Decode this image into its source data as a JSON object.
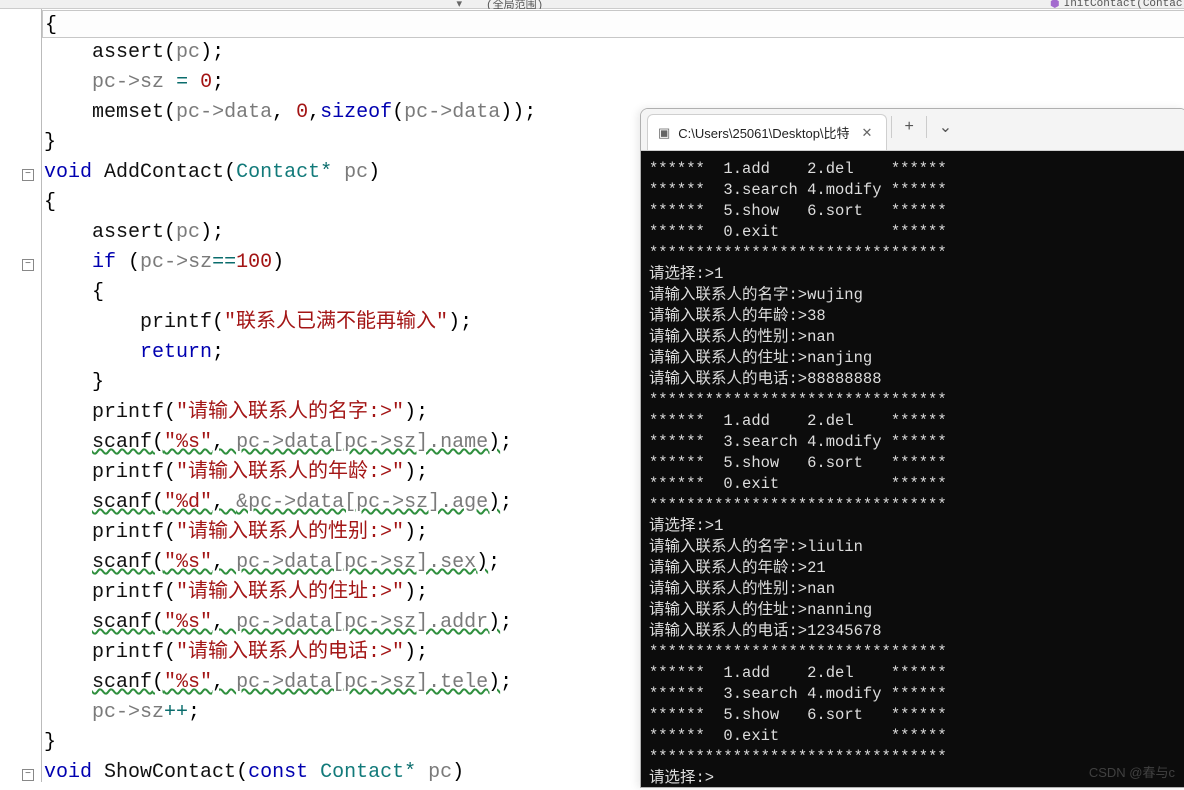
{
  "toolbar": {
    "scope_label": "(全局范围)",
    "symbol_label": "InitContact(Contac"
  },
  "code": {
    "lines": [
      {
        "indent": 0,
        "html": "{"
      },
      {
        "indent": 1,
        "html": "<span class='fn'>assert</span>(<span class='gy'>pc</span>);"
      },
      {
        "indent": 1,
        "html": "<span class='gy'>pc</span><span class='gy'>-&gt;</span><span class='gy'>sz</span> <span class='op'>=</span> <span class='num'>0</span>;"
      },
      {
        "indent": 1,
        "html": "<span class='fn'>memset</span>(<span class='gy'>pc</span><span class='gy'>-&gt;</span><span class='gy'>data</span>, <span class='num'>0</span>,<span class='kw'>sizeof</span>(<span class='gy'>pc</span><span class='gy'>-&gt;</span><span class='gy'>data</span>));"
      },
      {
        "indent": 0,
        "html": "}"
      },
      {
        "indent": 0,
        "html": "<span class='kw'>void</span> <span class='fn'>AddContact</span>(<span class='ty'>Contact</span><span class='op'>*</span> <span class='gy'>pc</span>)"
      },
      {
        "indent": 0,
        "html": "{"
      },
      {
        "indent": 1,
        "html": "<span class='fn'>assert</span>(<span class='gy'>pc</span>);"
      },
      {
        "indent": 1,
        "html": "<span class='kw'>if</span> (<span class='gy'>pc</span><span class='gy'>-&gt;</span><span class='gy'>sz</span><span class='op'>==</span><span class='num'>100</span>)"
      },
      {
        "indent": 1,
        "html": "{"
      },
      {
        "indent": 2,
        "html": "<span class='fn'>printf</span>(<span class='str'>\"联系人已满不能再输入\"</span>);"
      },
      {
        "indent": 2,
        "html": "<span class='kw'>return</span>;"
      },
      {
        "indent": 1,
        "html": "}"
      },
      {
        "indent": 1,
        "html": "<span class='fn'>printf</span>(<span class='str'>\"请输入联系人的名字:&gt;\"</span>);"
      },
      {
        "indent": 1,
        "html": "<span class='wavy'><span class='fn'>scanf</span>(<span class='str'>\"%s\"</span>, <span class='gy'>pc-&gt;data[pc-&gt;sz].name</span>)</span>;"
      },
      {
        "indent": 1,
        "html": "<span class='fn'>printf</span>(<span class='str'>\"请输入联系人的年龄:&gt;\"</span>);"
      },
      {
        "indent": 1,
        "html": "<span class='wavy'><span class='fn'>scanf</span>(<span class='str'>\"%d\"</span>, <span class='gy'>&amp;pc-&gt;data[pc-&gt;sz].age</span>)</span>;"
      },
      {
        "indent": 1,
        "html": "<span class='fn'>printf</span>(<span class='str'>\"请输入联系人的性别:&gt;\"</span>);"
      },
      {
        "indent": 1,
        "html": "<span class='wavy'><span class='fn'>scanf</span>(<span class='str'>\"%s\"</span>, <span class='gy'>pc-&gt;data[pc-&gt;sz].sex</span>)</span>;"
      },
      {
        "indent": 1,
        "html": "<span class='fn'>printf</span>(<span class='str'>\"请输入联系人的住址:&gt;\"</span>);"
      },
      {
        "indent": 1,
        "html": "<span class='wavy'><span class='fn'>scanf</span>(<span class='str'>\"%s\"</span>, <span class='gy'>pc-&gt;data[pc-&gt;sz].addr</span>)</span>;"
      },
      {
        "indent": 1,
        "html": "<span class='fn'>printf</span>(<span class='str'>\"请输入联系人的电话:&gt;\"</span>);"
      },
      {
        "indent": 1,
        "html": "<span class='wavy'><span class='fn'>scanf</span>(<span class='str'>\"%s\"</span>, <span class='gy'>pc-&gt;data[pc-&gt;sz].tele</span>)</span>;"
      },
      {
        "indent": 1,
        "html": "<span class='gy'>pc-&gt;sz</span><span class='op'>++</span>;"
      },
      {
        "indent": 0,
        "html": "}"
      },
      {
        "indent": 0,
        "html": "<span class='kw'>void</span> <span class='fn'>ShowContact</span>(<span class='kw'>const</span> <span class='ty'>Contact</span><span class='op'>*</span> <span class='gy'>pc</span>)"
      }
    ],
    "fold_rows": {
      "5": "-",
      "8": "-",
      "25": "-"
    }
  },
  "terminal": {
    "tab_title": "C:\\Users\\25061\\Desktop\\比特",
    "lines": [
      "******  1.add    2.del    ******",
      "******  3.search 4.modify ******",
      "******  5.show   6.sort   ******",
      "******  0.exit            ******",
      "********************************",
      "请选择:>1",
      "请输入联系人的名字:>wujing",
      "请输入联系人的年龄:>38",
      "请输入联系人的性别:>nan",
      "请输入联系人的住址:>nanjing",
      "请输入联系人的电话:>88888888",
      "********************************",
      "******  1.add    2.del    ******",
      "******  3.search 4.modify ******",
      "******  5.show   6.sort   ******",
      "******  0.exit            ******",
      "********************************",
      "请选择:>1",
      "请输入联系人的名字:>liulin",
      "请输入联系人的年龄:>21",
      "请输入联系人的性别:>nan",
      "请输入联系人的住址:>nanning",
      "请输入联系人的电话:>12345678",
      "********************************",
      "******  1.add    2.del    ******",
      "******  3.search 4.modify ******",
      "******  5.show   6.sort   ******",
      "******  0.exit            ******",
      "********************************",
      "请选择:>"
    ]
  },
  "watermark": "CSDN @春与c"
}
